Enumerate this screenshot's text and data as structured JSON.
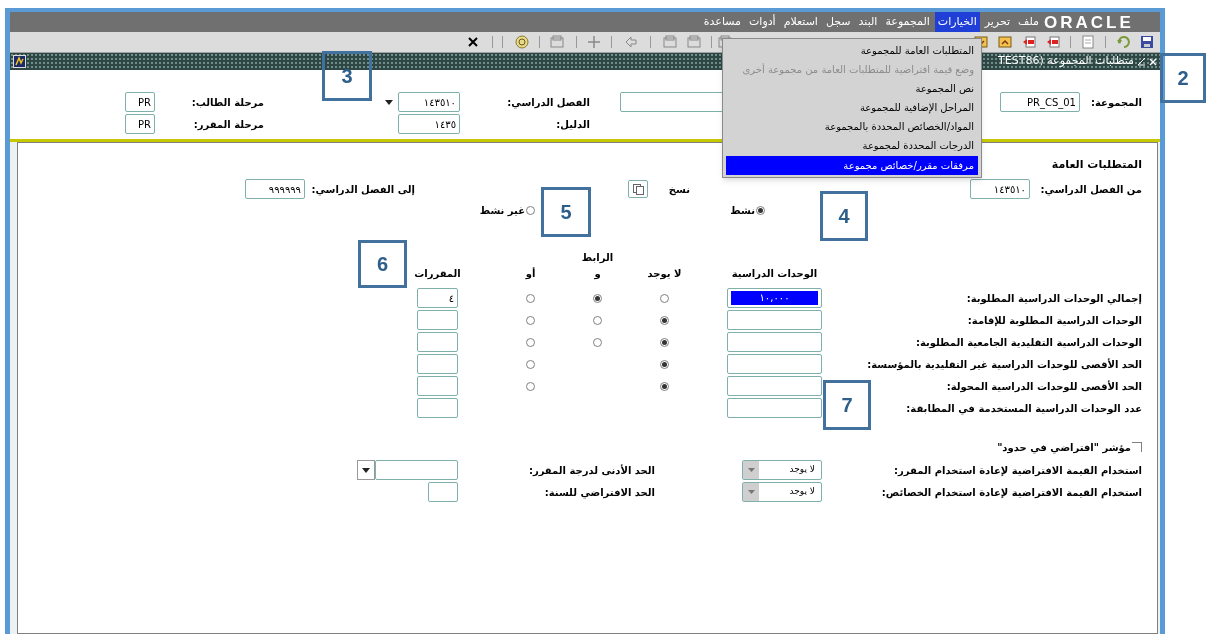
{
  "menu_bar": {
    "logo": "ORACLE",
    "items": [
      {
        "label": "ملف",
        "selected": false
      },
      {
        "label": "تحرير",
        "selected": false
      },
      {
        "label": "الخيارات",
        "selected": true
      },
      {
        "label": "المجموعة",
        "selected": false
      },
      {
        "label": "البند",
        "selected": false
      },
      {
        "label": "سجل",
        "selected": false
      },
      {
        "label": "استعلام",
        "selected": false
      },
      {
        "label": "أدوات",
        "selected": false
      },
      {
        "label": "مساعدة",
        "selected": false
      }
    ]
  },
  "options_menu": {
    "items": [
      {
        "label": "المتطلبات العامة للمجموعة",
        "disabled": false,
        "selected": false
      },
      {
        "label": "وضع قيمة افتراضية للمتطلبات العامة من مجموعة أخرى",
        "disabled": true,
        "selected": false
      },
      {
        "label": "نص المجموعة",
        "disabled": false,
        "selected": false
      },
      {
        "label": "المراحل الإضافية للمجموعة",
        "disabled": false,
        "selected": false
      },
      {
        "label": "المواد/الخصائص المحددة بالمجموعة",
        "disabled": false,
        "selected": false
      },
      {
        "label": "الدرجات المحددة لمجموعة",
        "disabled": false,
        "selected": false
      },
      {
        "label": "مرفقات مقرر/خصائص مجموعة",
        "disabled": false,
        "selected": true
      }
    ]
  },
  "window": {
    "title": "متطلبات المجموعة (TEST86"
  },
  "header": {
    "group_label": "المجموعة:",
    "group": "PR_CS_01",
    "term_label": "الفصل الدراسي:",
    "term": "١٤٣٥١٠",
    "catalog_label": "الدليل:",
    "catalog": "١٤٣٥",
    "student_level_label": "مرحلة الطالب:",
    "student_level": "PR",
    "course_level_label": "مرحلة المقرر:",
    "course_level": "PR"
  },
  "general": {
    "title": "المتطلبات العامة",
    "from_term_label": "من الفصل الدراسي:",
    "from_term": "١٤٣٥١٠",
    "copy_label": "نسخ",
    "to_term_label": "إلى الفصل الدراسي:",
    "to_term": "٩٩٩٩٩٩",
    "status": [
      {
        "label": "نشط",
        "selected": true
      },
      {
        "label": "غير نشط",
        "selected": false
      }
    ],
    "connector_label": "الرابط",
    "columns": [
      "الوحدات الدراسية",
      "لا يوجد",
      "و",
      "أو",
      "المقررات"
    ],
    "rows": [
      {
        "label": "إجمالي الوحدات الدراسية المطلوبة:",
        "units": "١٠,٠٠٠",
        "selected": true,
        "connector": [
          {
            "kind": "none",
            "selected": false
          },
          {
            "kind": "and",
            "selected": true
          },
          {
            "kind": "or",
            "selected": false
          }
        ],
        "courses": "٤"
      },
      {
        "label": "الوحدات الدراسية المطلوبة للإقامة:",
        "selected": false,
        "connector": [
          {
            "kind": "none",
            "selected": true
          },
          {
            "kind": "and",
            "selected": false
          },
          {
            "kind": "or",
            "selected": false
          }
        ]
      },
      {
        "label": "الوحدات الدراسية التقليدية الجامعية المطلوبة:",
        "selected": false,
        "connector": [
          {
            "kind": "none",
            "selected": true
          },
          {
            "kind": "and",
            "selected": false
          },
          {
            "kind": "or",
            "selected": false
          }
        ]
      },
      {
        "label": "الحد الأقصى للوحدات الدراسية غير التقليدية بالمؤسسة:",
        "selected": false,
        "connector": [
          {
            "kind": "none",
            "selected": true
          },
          {
            "kind": "or",
            "selected": false
          }
        ]
      },
      {
        "label": "الحد الأقصى للوحدات الدراسية المحولة:",
        "selected": false,
        "connector": [
          {
            "kind": "none",
            "selected": true
          },
          {
            "kind": "or",
            "selected": false
          }
        ]
      },
      {
        "label": "عدد الوحدات الدراسية المستخدمة في المطابقة:",
        "selected": false
      }
    ],
    "default_within_limits": {
      "label": "مؤشر \"افتراضي في حدود\"",
      "checked": false
    },
    "reuse": [
      {
        "label": "استخدام القيمة الافتراضية لإعادة استخدام المقرر:",
        "value": "لا يوجد",
        "side_label": "الحد الأدنى لدرجة المقرر:",
        "kind": "dropdown"
      },
      {
        "label": "استخدام القيمة الافتراضية لإعادة استخدام الخصائص:",
        "value": "لا يوجد",
        "side_label": "الحد الافتراضي للسنة:",
        "kind": "short"
      }
    ]
  },
  "callouts": [
    "2",
    "3",
    "4",
    "5",
    "6",
    "7"
  ]
}
